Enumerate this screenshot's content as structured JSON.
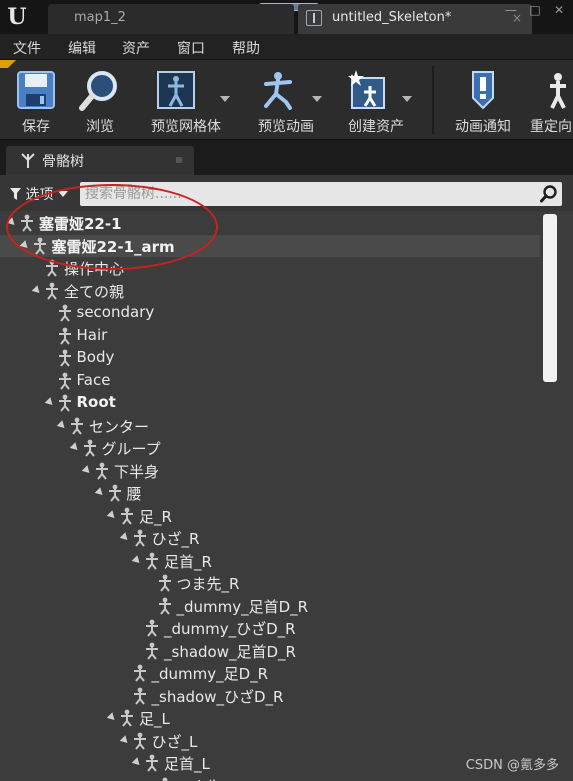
{
  "window": {
    "tabs": [
      {
        "label": "map1_2",
        "active": false
      },
      {
        "label": "untitled_Skeleton",
        "suffix": "*",
        "active": true
      }
    ],
    "close_glyph": "×",
    "controls": {
      "minimize": "—",
      "maximize": "□",
      "close": "✕"
    }
  },
  "menu": [
    "文件",
    "编辑",
    "资产",
    "窗口",
    "帮助"
  ],
  "toolbar": [
    {
      "label": "保存",
      "icon": "save-icon"
    },
    {
      "label": "浏览",
      "icon": "browse-icon"
    },
    {
      "label": "预览网格体",
      "icon": "preview-mesh-icon",
      "dropdown": true
    },
    {
      "label": "预览动画",
      "icon": "preview-animation-icon",
      "dropdown": true
    },
    {
      "label": "创建资产",
      "icon": "create-asset-icon",
      "dropdown": true
    },
    {
      "label": "动画通知",
      "icon": "anim-notify-icon"
    },
    {
      "label": "重定向",
      "icon": "retarget-icon"
    }
  ],
  "panel": {
    "title": "骨骼树",
    "options_label": "选项",
    "search_placeholder": "搜索骨骼树......"
  },
  "tree": [
    {
      "label": "塞雷娅22-1",
      "depth": 0,
      "expanded": true,
      "bold": true
    },
    {
      "label": "塞雷娅22-1_arm",
      "depth": 1,
      "expanded": true,
      "bold": true,
      "selected": true
    },
    {
      "label": "操作中心",
      "depth": 2,
      "expanded": false
    },
    {
      "label": "全ての親",
      "depth": 2,
      "expanded": true
    },
    {
      "label": "secondary",
      "depth": 3,
      "expanded": false
    },
    {
      "label": "Hair",
      "depth": 3,
      "expanded": false
    },
    {
      "label": "Body",
      "depth": 3,
      "expanded": false
    },
    {
      "label": "Face",
      "depth": 3,
      "expanded": false
    },
    {
      "label": "Root",
      "depth": 3,
      "expanded": true,
      "bold": true
    },
    {
      "label": "センター",
      "depth": 4,
      "expanded": true
    },
    {
      "label": "グループ",
      "depth": 5,
      "expanded": true
    },
    {
      "label": "下半身",
      "depth": 6,
      "expanded": true
    },
    {
      "label": "腰",
      "depth": 7,
      "expanded": true
    },
    {
      "label": "足_R",
      "depth": 8,
      "expanded": true
    },
    {
      "label": "ひざ_R",
      "depth": 9,
      "expanded": true
    },
    {
      "label": "足首_R",
      "depth": 10,
      "expanded": true
    },
    {
      "label": "つま先_R",
      "depth": 11,
      "expanded": false
    },
    {
      "label": "_dummy_足首D_R",
      "depth": 11,
      "expanded": false
    },
    {
      "label": "_dummy_ひざD_R",
      "depth": 10,
      "expanded": false
    },
    {
      "label": "_shadow_足首D_R",
      "depth": 10,
      "expanded": false
    },
    {
      "label": "_dummy_足D_R",
      "depth": 9,
      "expanded": false
    },
    {
      "label": "_shadow_ひざD_R",
      "depth": 9,
      "expanded": false
    },
    {
      "label": "足_L",
      "depth": 8,
      "expanded": true
    },
    {
      "label": "ひざ_L",
      "depth": 9,
      "expanded": true
    },
    {
      "label": "足首_L",
      "depth": 10,
      "expanded": true
    },
    {
      "label": "つま先_L",
      "depth": 11,
      "expanded": false
    }
  ],
  "watermark": "CSDN @氪多多",
  "colors": {
    "annotation": "#cc2020",
    "panel_bg": "#3c3c3c",
    "selection": "#4a4a4a"
  }
}
